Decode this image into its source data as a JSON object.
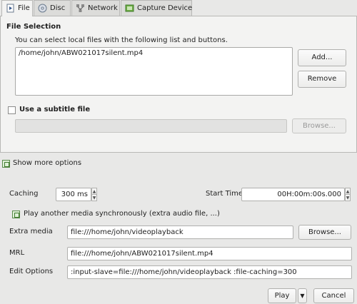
{
  "tabs": [
    {
      "label": "File",
      "icon": "file-icon"
    },
    {
      "label": "Disc",
      "icon": "disc-icon"
    },
    {
      "label": "Network",
      "icon": "network-icon"
    },
    {
      "label": "Capture Device",
      "icon": "capture-device-icon"
    }
  ],
  "file_selection": {
    "title": "File Selection",
    "description": "You can select local files with the following list and buttons.",
    "files": [
      "/home/john/ABW021017silent.mp4"
    ],
    "add_label": "Add...",
    "remove_label": "Remove"
  },
  "subtitle": {
    "label": "Use a subtitle file",
    "browse_label": "Browse..."
  },
  "show_more": {
    "label": "Show more options"
  },
  "options": {
    "caching_label": "Caching",
    "caching_value": "300 ms",
    "start_time_label": "Start Time",
    "start_time_value": "00H:00m:00s.000",
    "play_another_label": "Play another media synchronously (extra audio file, ...)",
    "extra_media_label": "Extra media",
    "extra_media_value": "file:///home/john/videoplayback",
    "extra_browse_label": "Browse...",
    "mrl_label": "MRL",
    "mrl_value": "file:///home/john/ABW021017silent.mp4",
    "edit_options_label": "Edit Options",
    "edit_options_value": ":input-slave=file:///home/john/videoplayback :file-caching=300"
  },
  "footer": {
    "play_label": "Play",
    "cancel_label": "Cancel"
  }
}
